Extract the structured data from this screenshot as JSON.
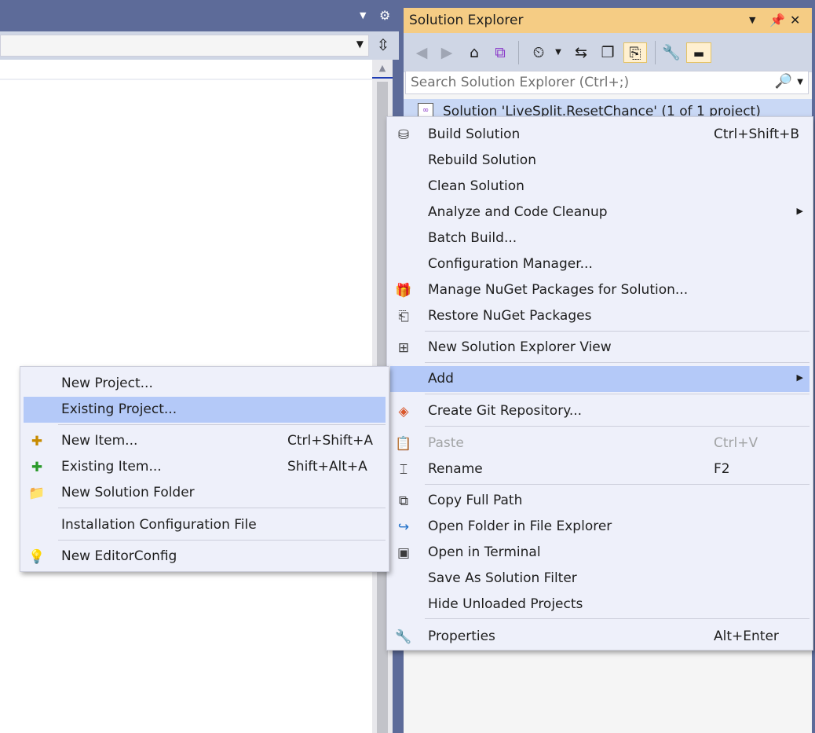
{
  "solution_explorer": {
    "title": "Solution Explorer",
    "search_placeholder": "Search Solution Explorer (Ctrl+;)",
    "root_label": "Solution 'LiveSplit.ResetChance' (1 of 1 project)"
  },
  "solution_context_menu": {
    "items": [
      {
        "label": "Build Solution",
        "shortcut": "Ctrl+Shift+B",
        "icon": "build-icon"
      },
      {
        "label": "Rebuild Solution",
        "shortcut": ""
      },
      {
        "label": "Clean Solution",
        "shortcut": ""
      },
      {
        "label": "Analyze and Code Cleanup",
        "shortcut": "",
        "submenu": true
      },
      {
        "label": "Batch Build...",
        "shortcut": ""
      },
      {
        "label": "Configuration Manager...",
        "shortcut": ""
      },
      {
        "label": "Manage NuGet Packages for Solution...",
        "shortcut": "",
        "icon": "nuget-package-icon"
      },
      {
        "label": "Restore NuGet Packages",
        "shortcut": "",
        "icon": "restore-packages-icon"
      },
      {
        "label": "New Solution Explorer View",
        "shortcut": "",
        "icon": "new-view-icon"
      },
      {
        "label": "Add",
        "shortcut": "",
        "submenu": true,
        "highlighted": true
      },
      {
        "label": "Create Git Repository...",
        "shortcut": "",
        "icon": "git-icon"
      },
      {
        "label": "Paste",
        "shortcut": "Ctrl+V",
        "icon": "paste-icon",
        "disabled": true
      },
      {
        "label": "Rename",
        "shortcut": "F2",
        "icon": "rename-icon"
      },
      {
        "label": "Copy Full Path",
        "shortcut": "",
        "icon": "copy-icon"
      },
      {
        "label": "Open Folder in File Explorer",
        "shortcut": "",
        "icon": "open-folder-icon"
      },
      {
        "label": "Open in Terminal",
        "shortcut": "",
        "icon": "terminal-icon"
      },
      {
        "label": "Save As Solution Filter",
        "shortcut": ""
      },
      {
        "label": "Hide Unloaded Projects",
        "shortcut": ""
      },
      {
        "label": "Properties",
        "shortcut": "Alt+Enter",
        "icon": "wrench-icon"
      }
    ]
  },
  "add_submenu": {
    "items": [
      {
        "label": "New Project...",
        "shortcut": ""
      },
      {
        "label": "Existing Project...",
        "shortcut": "",
        "highlighted": true
      },
      {
        "label": "New Item...",
        "shortcut": "Ctrl+Shift+A",
        "icon": "new-item-icon"
      },
      {
        "label": "Existing Item...",
        "shortcut": "Shift+Alt+A",
        "icon": "existing-item-icon"
      },
      {
        "label": "New Solution Folder",
        "shortcut": "",
        "icon": "solution-folder-icon"
      },
      {
        "label": "Installation Configuration File",
        "shortcut": ""
      },
      {
        "label": "New EditorConfig",
        "shortcut": "",
        "icon": "lightbulb-icon"
      }
    ]
  },
  "colors": {
    "chrome": "#5d6b99",
    "panel_title_active": "#f5cc84",
    "menu_bg": "#eef0fa",
    "menu_highlight": "#b4c9f8",
    "selection": "#c9d8f5"
  }
}
